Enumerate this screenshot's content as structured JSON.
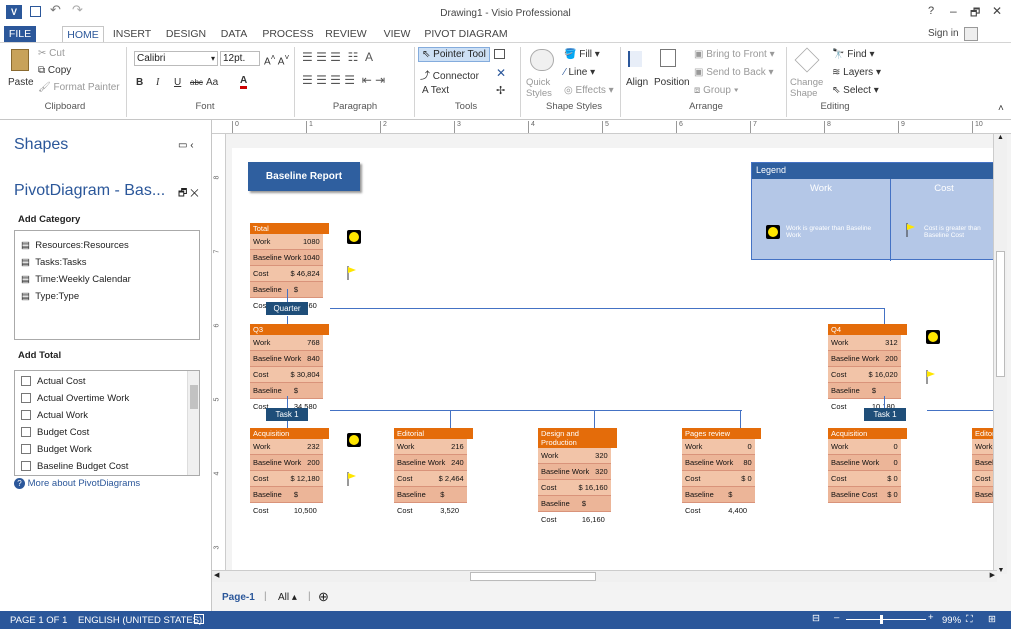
{
  "titlebar": {
    "title": "Drawing1 - Visio Professional",
    "help": "?",
    "min": "–",
    "restore": "🗗",
    "close": "✕",
    "app_icon": "V"
  },
  "tabs": [
    "FILE",
    "HOME",
    "INSERT",
    "DESIGN",
    "DATA",
    "PROCESS",
    "REVIEW",
    "VIEW",
    "PIVOT DIAGRAM"
  ],
  "signin": "Sign in",
  "ribbon": {
    "clipboard": {
      "paste": "Paste",
      "cut": "Cut",
      "copy": "Copy",
      "format_painter": "Format Painter",
      "label": "Clipboard"
    },
    "font": {
      "name": "Calibri",
      "size": "12pt.",
      "label": "Font",
      "bold": "B",
      "italic": "I",
      "underline": "U",
      "strike": "abc",
      "aa": "Aa"
    },
    "paragraph": {
      "label": "Paragraph"
    },
    "tools": {
      "pointer": "Pointer Tool",
      "connector": "Connector",
      "text": "Text",
      "label": "Tools"
    },
    "shape_styles": {
      "quick": "Quick Styles",
      "fill": "Fill",
      "line": "Line",
      "effects": "Effects",
      "label": "Shape Styles"
    },
    "arrange": {
      "align": "Align",
      "position": "Position",
      "bring": "Bring to Front",
      "send": "Send to Back",
      "group": "Group",
      "label": "Arrange"
    },
    "editing": {
      "change": "Change Shape",
      "find": "Find",
      "layers": "Layers",
      "select": "Select",
      "label": "Editing"
    }
  },
  "shapes_pane": {
    "title": "Shapes",
    "pivot_title": "PivotDiagram - Bas...",
    "add_category": "Add Category",
    "categories": [
      "Resources:Resources",
      "Tasks:Tasks",
      "Time:Weekly Calendar",
      "Type:Type"
    ],
    "add_total": "Add Total",
    "totals": [
      "Actual Cost",
      "Actual Overtime Work",
      "Actual Work",
      "Budget Cost",
      "Budget Work",
      "Baseline Budget Cost"
    ],
    "more": "More about PivotDiagrams"
  },
  "ruler": [
    "0",
    "1",
    "2",
    "3",
    "4",
    "5",
    "6",
    "7",
    "8",
    "9",
    "10"
  ],
  "vruler": [
    "8",
    "7",
    "6",
    "5",
    "4",
    "3"
  ],
  "diagram": {
    "report_title": "Baseline Report",
    "legend": {
      "title": "Legend",
      "work": "Work",
      "cost": "Cost",
      "work_note": "Work is greater than Baseline Work",
      "cost_note": "Cost is greater than Baseline Cost"
    },
    "quarter": "Quarter",
    "task1": "Task 1",
    "total": {
      "name": "Total",
      "work": "1080",
      "bwork": "1040",
      "cost": "$ 46,824",
      "bcost": "$ 44,760"
    },
    "q3": {
      "name": "Q3",
      "work": "768",
      "bwork": "840",
      "cost": "$ 30,804",
      "bcost": "$ 34,580"
    },
    "q4": {
      "name": "Q4",
      "work": "312",
      "bwork": "200",
      "cost": "$ 16,020",
      "bcost": "$ 10,180"
    },
    "acq": {
      "name": "Acquisition",
      "work": "232",
      "bwork": "200",
      "cost": "$ 12,180",
      "bcost": "$ 10,500"
    },
    "edit": {
      "name": "Editorial",
      "work": "216",
      "bwork": "240",
      "cost": "$ 2,464",
      "bcost": "$ 3,520"
    },
    "design": {
      "name": "Design and Production",
      "work": "320",
      "bwork": "320",
      "cost": "$ 16,160",
      "bcost": "$ 16,160"
    },
    "pages": {
      "name": "Pages review",
      "work": "0",
      "bwork": "80",
      "cost": "$ 0",
      "bcost": "$ 4,400"
    },
    "acq2": {
      "name": "Acquisition",
      "work": "0",
      "bwork": "0",
      "cost": "$ 0",
      "bcost": "$ 0"
    },
    "edit2": {
      "name": "Editor",
      "work": "Wo",
      "bwork": "Bas",
      "cost": "Cos",
      "bcost": "Bas"
    },
    "labels": {
      "work": "Work",
      "bwork": "Baseline Work",
      "cost": "Cost",
      "bcost": "Baseline Cost"
    }
  },
  "page_tabs": {
    "page1": "Page-1",
    "all": "All ▴",
    "add": "⊕"
  },
  "status": {
    "page": "PAGE 1 OF 1",
    "lang": "ENGLISH (UNITED STATES)",
    "zoom": "99%"
  }
}
